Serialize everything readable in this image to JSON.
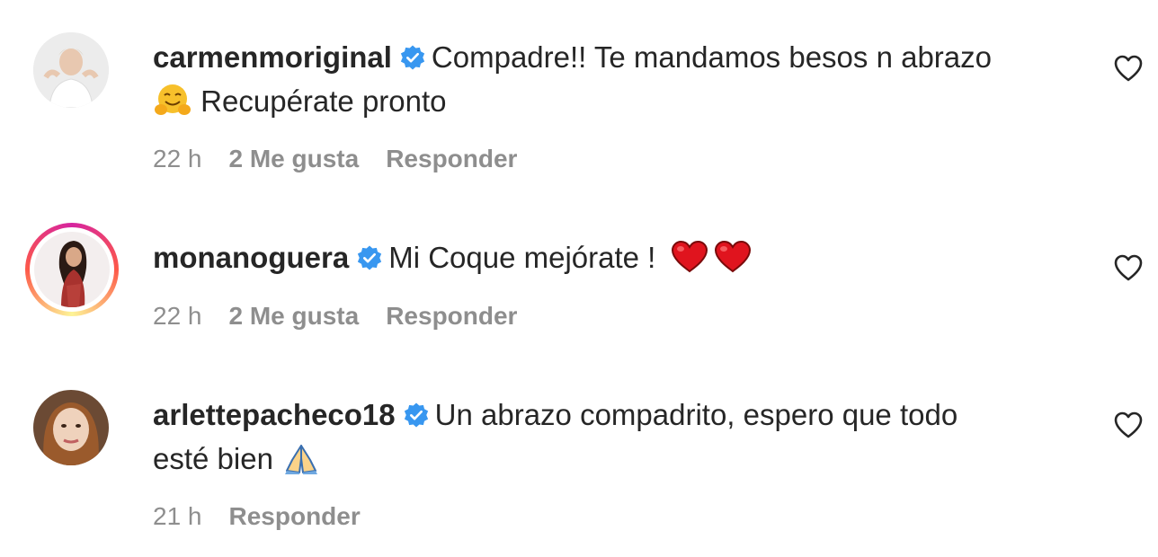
{
  "comments": [
    {
      "username": "carmenmoriginal",
      "text_line1": "Compadre!! Te mandamos besos n abrazo",
      "emoji1": "hugging-face",
      "text_line2": "Recupérate pronto",
      "time": "22 h",
      "likes": "2 Me gusta",
      "reply": "Responder"
    },
    {
      "username": "monanoguera",
      "text_line1": "Mi Coque mejórate !",
      "emoji1": "red-heart",
      "emoji2": "red-heart",
      "time": "22 h",
      "likes": "2 Me gusta",
      "reply": "Responder"
    },
    {
      "username": "arlettepacheco18",
      "text_line1": "Un abrazo compadrito, espero que todo",
      "text_line2": "esté bien",
      "emoji1": "folded-hands",
      "time": "21 h",
      "reply": "Responder"
    }
  ],
  "colors": {
    "text": "#262626",
    "secondary": "#8e8e8e",
    "verified": "#3897f0"
  }
}
